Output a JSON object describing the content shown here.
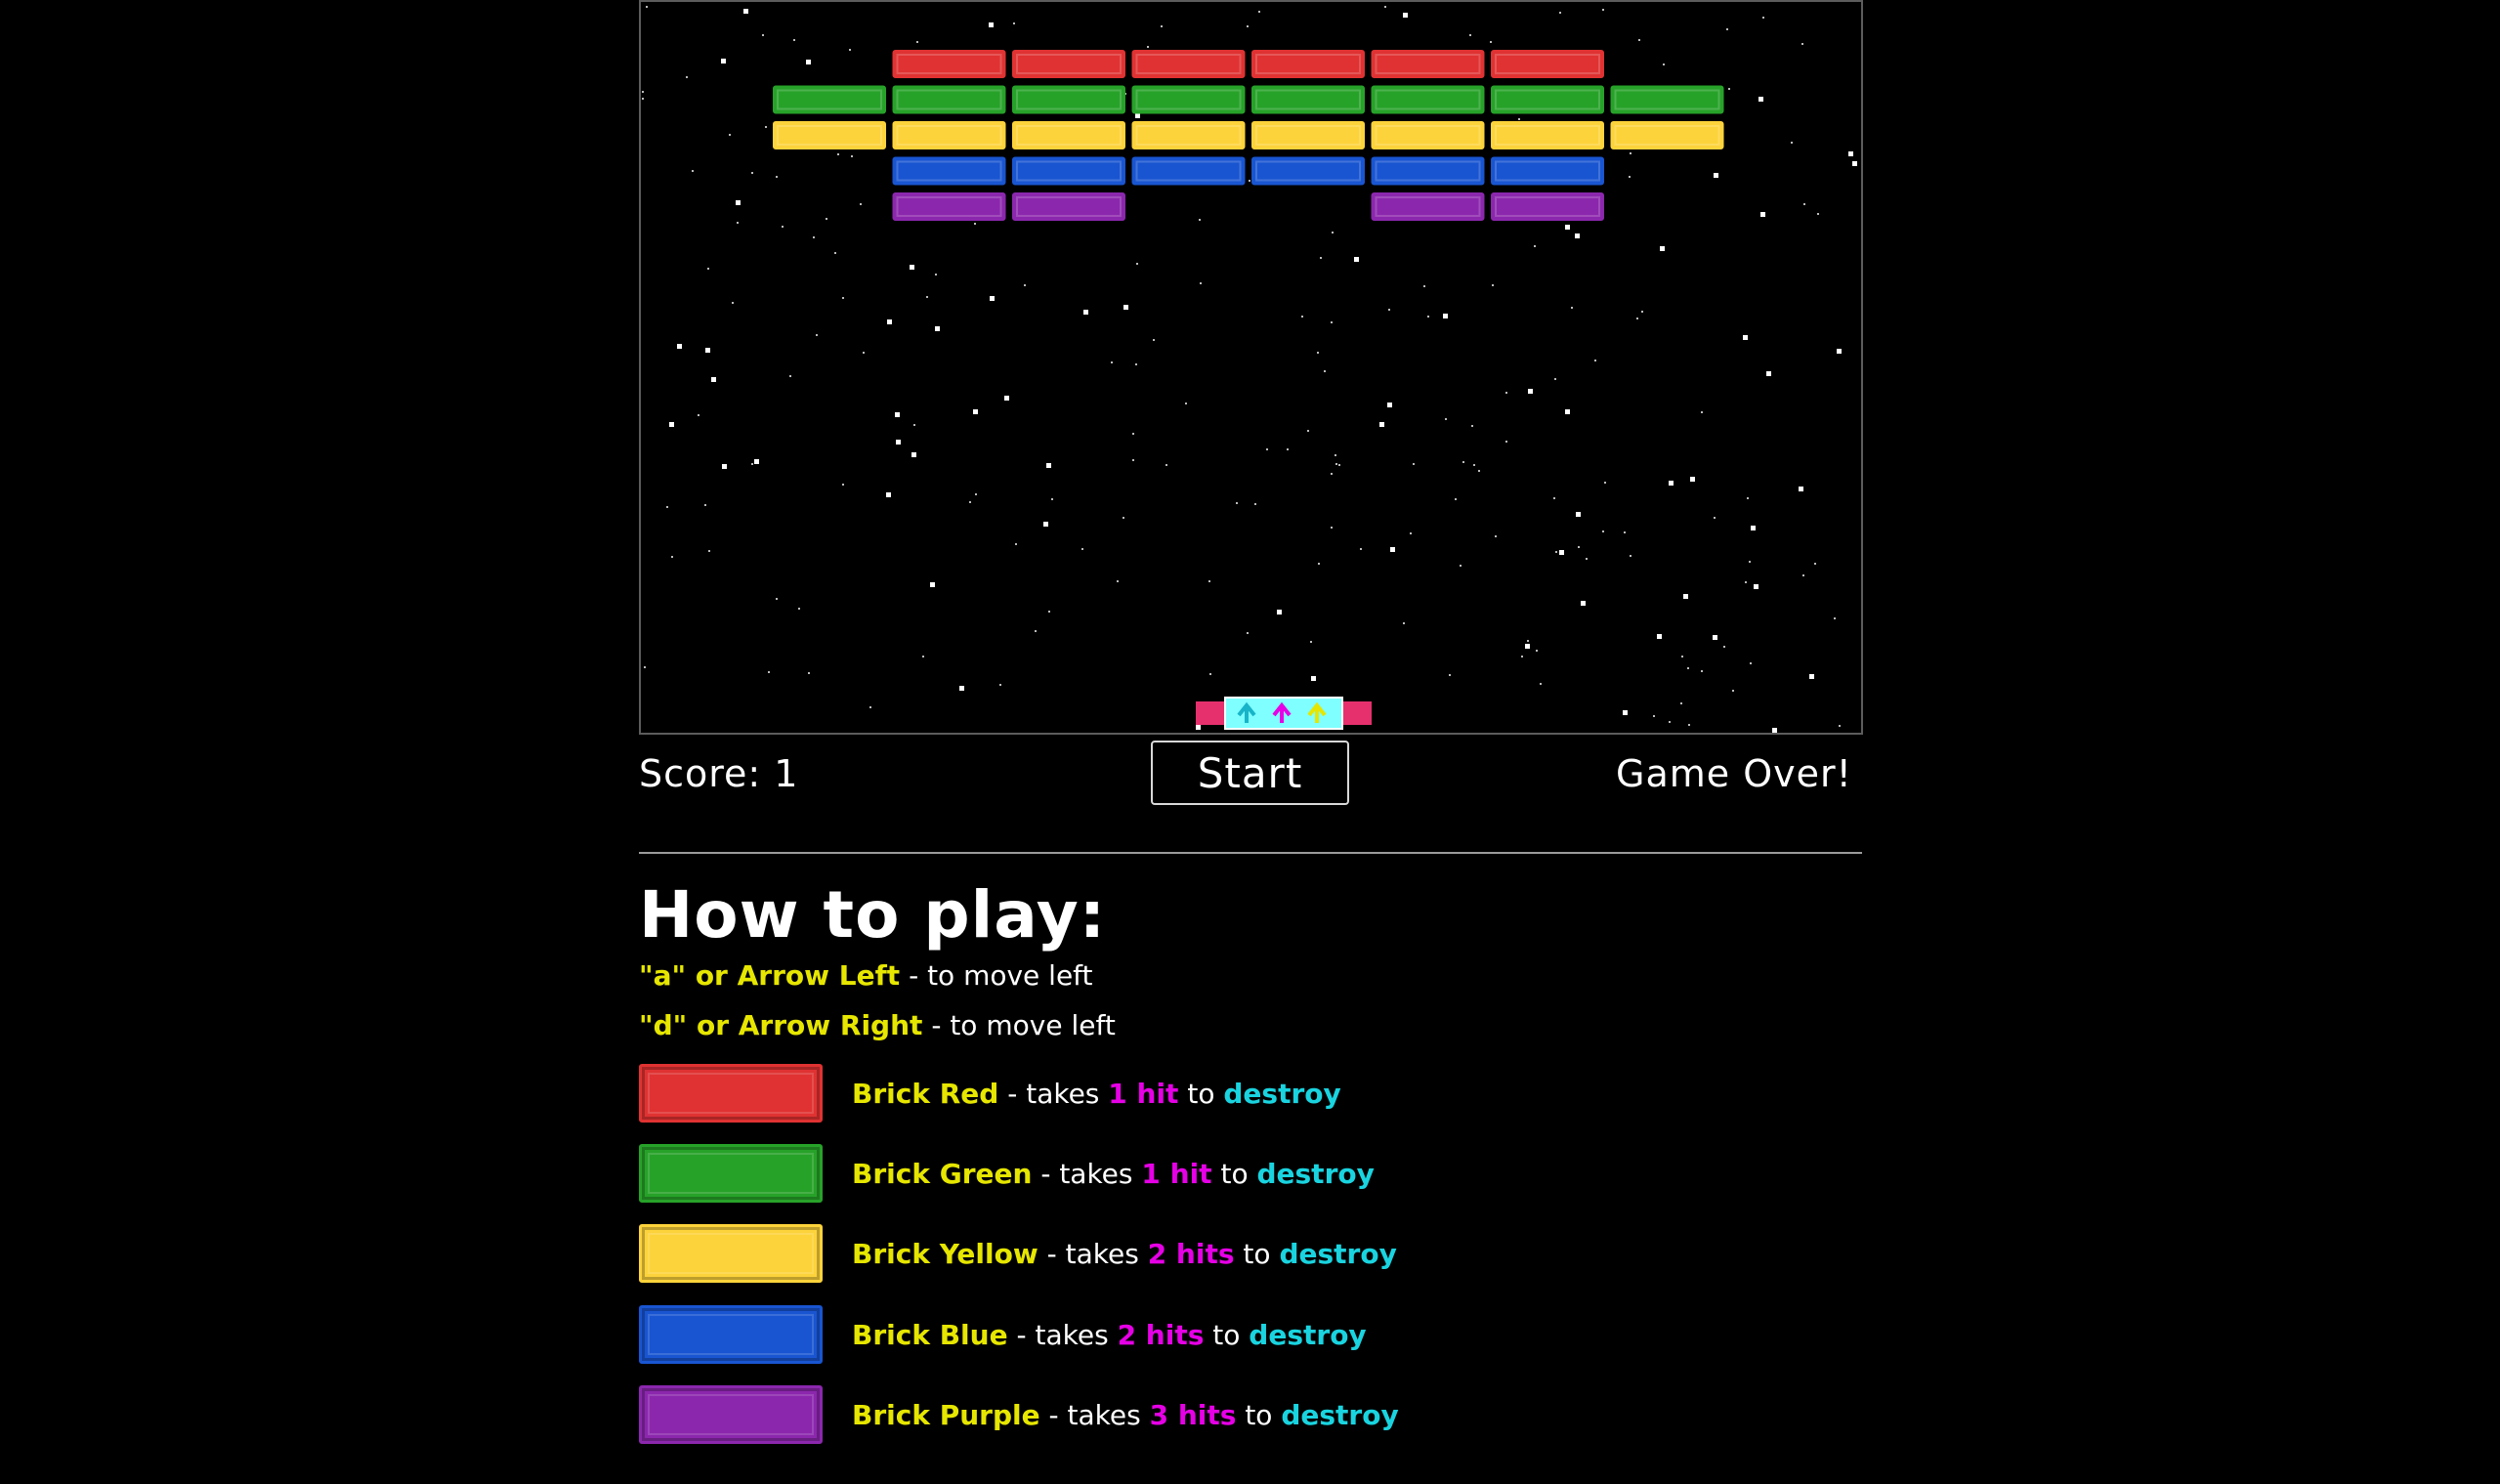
{
  "game": {
    "bricks": [
      {
        "row": 0,
        "cols": [
          1,
          2,
          3,
          4,
          5,
          6
        ],
        "color": "red"
      },
      {
        "row": 1,
        "cols": [
          0,
          1,
          2,
          3,
          4,
          5,
          6,
          7
        ],
        "color": "green"
      },
      {
        "row": 2,
        "cols": [
          0,
          1,
          2,
          3,
          4,
          5,
          6,
          7
        ],
        "color": "yellow"
      },
      {
        "row": 3,
        "cols": [
          1,
          2,
          3,
          4,
          5,
          6
        ],
        "color": "blue"
      },
      {
        "row": 4,
        "cols": [
          1,
          2,
          5,
          6
        ],
        "color": "purple"
      }
    ]
  },
  "colors": {
    "red": "#e03232",
    "green": "#27a229",
    "yellow": "#fdd33b",
    "blue": "#1955d1",
    "purple": "#8b27ad",
    "paddle_core": "#7fffff",
    "paddle_ends": "#e6306e"
  },
  "hud": {
    "score_label": "Score: 1",
    "start_label": "Start",
    "status_text": "Game Over!"
  },
  "howto": {
    "title": "How to play:",
    "controls": [
      {
        "key": "\"a\" or Arrow Left",
        "desc": "- to move left"
      },
      {
        "key": "\"d\" or Arrow Right",
        "desc": "- to move left"
      }
    ],
    "bricks": [
      {
        "name": "Brick Red",
        "mid": "- takes",
        "hits": "1 hit",
        "to": "to",
        "action": "destroy",
        "color": "red"
      },
      {
        "name": "Brick Green",
        "mid": "- takes",
        "hits": "1 hit",
        "to": "to",
        "action": "destroy",
        "color": "green"
      },
      {
        "name": "Brick Yellow",
        "mid": "- takes",
        "hits": "2 hits",
        "to": "to",
        "action": "destroy",
        "color": "yellow"
      },
      {
        "name": "Brick Blue",
        "mid": "- takes",
        "hits": "2 hits",
        "to": "to",
        "action": "destroy",
        "color": "blue"
      },
      {
        "name": "Brick Purple",
        "mid": "- takes",
        "hits": "3 hits",
        "to": "to",
        "action": "destroy",
        "color": "purple"
      }
    ]
  }
}
